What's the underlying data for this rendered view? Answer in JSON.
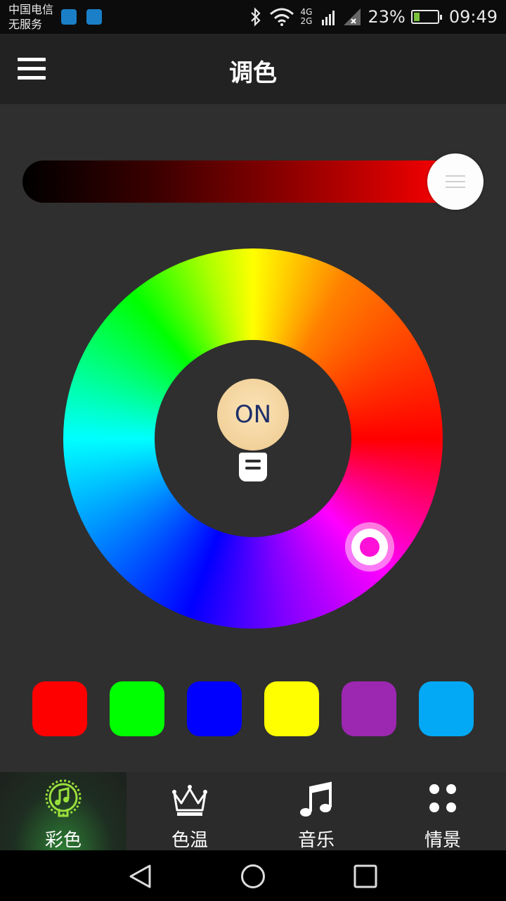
{
  "status": {
    "carrier_line1": "中国电信",
    "carrier_line2": "无服务",
    "network": "4G 2G",
    "battery": "23%",
    "time": "09:49"
  },
  "header": {
    "title": "调色"
  },
  "brightness": {
    "level": 1.0,
    "color": "#ff0000"
  },
  "wheel": {
    "power_label": "ON",
    "selected_color": "#ff10d8"
  },
  "swatches": [
    {
      "name": "red",
      "color": "#ff0000"
    },
    {
      "name": "green",
      "color": "#00ff00"
    },
    {
      "name": "blue",
      "color": "#0000ff"
    },
    {
      "name": "yellow",
      "color": "#ffff00"
    },
    {
      "name": "purple",
      "color": "#9c27b0"
    },
    {
      "name": "sky-blue",
      "color": "#03a9f4"
    }
  ],
  "tabs": [
    {
      "label": "彩色",
      "icon": "music-note-face-icon",
      "active": true
    },
    {
      "label": "色温",
      "icon": "crown-icon",
      "active": false
    },
    {
      "label": "音乐",
      "icon": "music-note-icon",
      "active": false
    },
    {
      "label": "情景",
      "icon": "four-dots-icon",
      "active": false
    }
  ],
  "nav": {
    "back": "back-icon",
    "home": "home-icon",
    "recents": "recents-icon"
  }
}
